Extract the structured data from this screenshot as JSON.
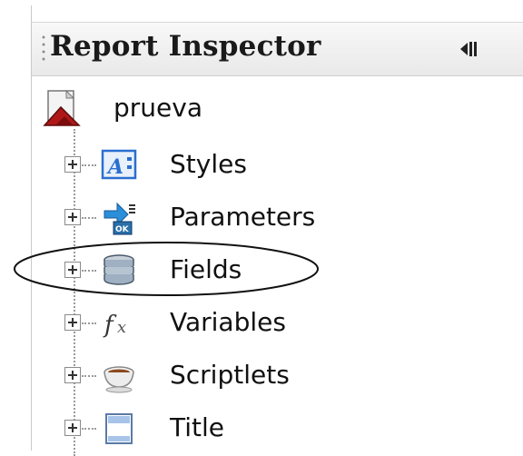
{
  "panel": {
    "title": "Report Inspector"
  },
  "tree": {
    "root": {
      "label": "prueva",
      "icon": "report-document-icon"
    },
    "items": [
      {
        "label": "Styles",
        "icon": "styles-icon"
      },
      {
        "label": "Parameters",
        "icon": "parameters-icon"
      },
      {
        "label": "Fields",
        "icon": "database-fields-icon"
      },
      {
        "label": "Variables",
        "icon": "fx-variables-icon"
      },
      {
        "label": "Scriptlets",
        "icon": "coffee-cup-icon"
      },
      {
        "label": "Title",
        "icon": "title-band-icon"
      }
    ]
  },
  "colors": {
    "header_bg": "#ececec",
    "styles_icon_blue": "#2a6fd0",
    "report_icon_red": "#b01818"
  }
}
